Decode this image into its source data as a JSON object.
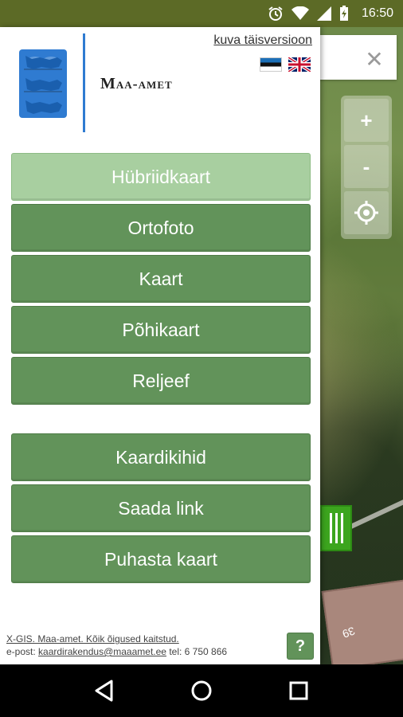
{
  "status_bar": {
    "time": "16:50",
    "icons": [
      "alarm-icon",
      "wifi-icon",
      "signal-icon",
      "battery-icon"
    ]
  },
  "header": {
    "org_name_lead": "M",
    "org_name_rest": "aa-amet",
    "full_version_link": "kuva täisversioon",
    "languages": [
      "et",
      "en"
    ]
  },
  "menu": {
    "map_types": [
      {
        "label": "Hübriidkaart",
        "active": true
      },
      {
        "label": "Ortofoto",
        "active": false
      },
      {
        "label": "Kaart",
        "active": false
      },
      {
        "label": "Põhikaart",
        "active": false
      },
      {
        "label": "Reljeef",
        "active": false
      }
    ],
    "actions": [
      {
        "label": "Kaardikihid"
      },
      {
        "label": "Saada link"
      },
      {
        "label": "Puhasta kaart"
      }
    ]
  },
  "footer": {
    "copyright": "X-GIS. Maa-amet. Kõik õigused kaitstud.",
    "email_label": "e-post:",
    "email": "kaardirakendus@maaamet.ee",
    "phone_label": "tel:",
    "phone": "6 750 866",
    "help_label": "?"
  },
  "map": {
    "close_symbol": "✕",
    "zoom_in": "+",
    "zoom_out": "-",
    "house_number": "39"
  },
  "colors": {
    "status_bar": "#5c6a26",
    "button": "#62935a",
    "button_active": "#a8cfa0",
    "divider": "#2f7bd1",
    "drawer_handle": "#3ca51e"
  }
}
